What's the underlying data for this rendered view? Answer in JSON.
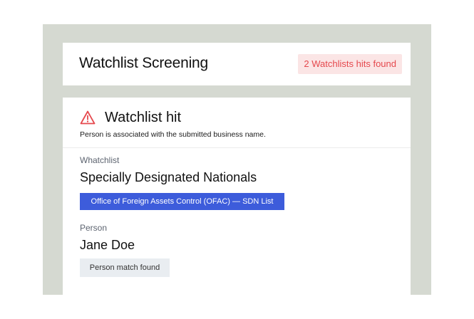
{
  "header": {
    "title": "Watchlist Screening",
    "hits_badge": "2 Watchlists hits found"
  },
  "hit": {
    "icon": "warning-triangle-icon",
    "title": "Watchlist hit",
    "subtitle": "Person is associated with the submitted business name."
  },
  "whatchlist": {
    "label": "Whatchlist",
    "value": "Specially Designated Nationals",
    "chip": "Office of Foreign Assets Control (OFAC) — SDN List"
  },
  "person": {
    "label": "Person",
    "value": "Jane Doe",
    "chip": "Person match found"
  },
  "colors": {
    "alert_red": "#e5484d",
    "badge_bg": "#fbe5e5",
    "chip_blue": "#3d5cdb",
    "frame_bg": "#d5d9d1"
  }
}
